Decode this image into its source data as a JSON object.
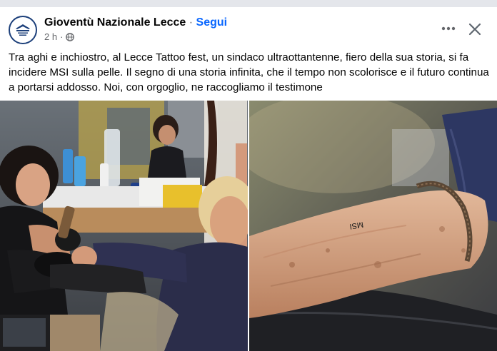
{
  "post": {
    "page_name": "Gioventù Nazionale Lecce",
    "separator": "·",
    "follow_label": "Segui",
    "time": "2 h",
    "meta_separator": "·",
    "visibility_icon": "globe-icon",
    "more_icon": "more-options-icon",
    "close_icon": "close-icon",
    "text": "Tra aghi e inchiostro, al Lecce Tattoo fest, un sindaco ultraottantenne, fiero della sua storia, si fa incidere MSI sulla pelle. Il segno di una storia infinita, che il tempo non scolorisce e il futuro continua a portarsi addosso. Noi, con orgoglio, ne raccogliamo il testimone"
  },
  "photos": {
    "right": {
      "tattoo_text": "MSI"
    }
  },
  "colors": {
    "link": "#0866ff",
    "text": "#050505",
    "secondary": "#65676b",
    "page_background": "#e4e6eb"
  }
}
